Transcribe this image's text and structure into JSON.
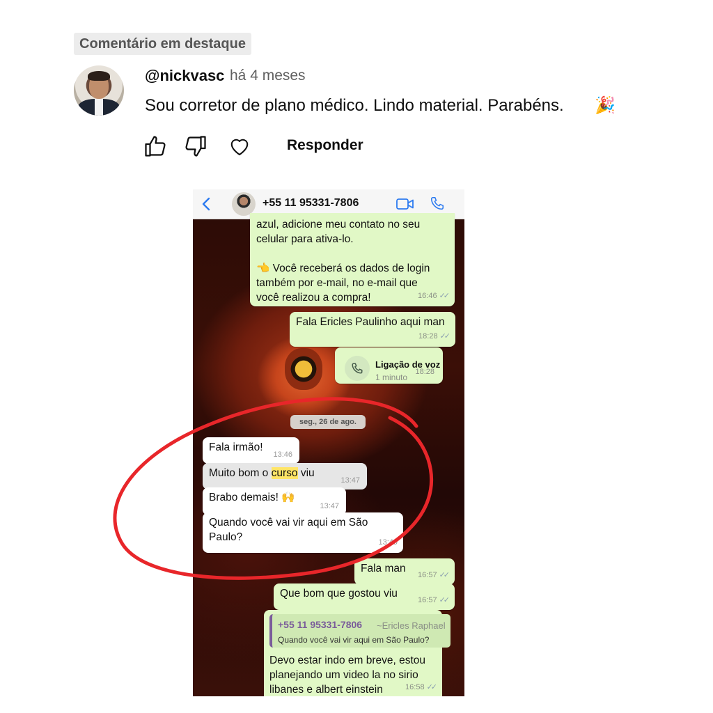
{
  "comment": {
    "pinned_label": "Comentário em destaque",
    "author": "@nickvasc",
    "time_ago": "há 4 meses",
    "text": "Sou corretor de plano médico. Lindo material. Parabéns.",
    "emoji": "🎉",
    "actions": {
      "like_icon": "thumbs-up-icon",
      "dislike_icon": "thumbs-down-icon",
      "heart_icon": "heart-icon",
      "reply_label": "Responder"
    }
  },
  "whatsapp": {
    "contact": "+55 11 95331-7806",
    "icons": [
      "back-chevron-icon",
      "video-call-icon",
      "phone-call-icon"
    ],
    "accent_color": "#2d7bf0",
    "messages": [
      {
        "dir": "out",
        "text_lines": [
          "azul, adicione meu contato no seu",
          "celular para ativa-lo."
        ]
      },
      {
        "dir": "out",
        "text_lines": [
          "👈 Você receberá os dados de login",
          "também por e-mail, no e-mail que",
          "você realizou a compra!"
        ],
        "time": "16:46"
      },
      {
        "dir": "out",
        "text": "Fala Ericles Paulinho aqui man",
        "time": "18:28"
      },
      {
        "dir": "out",
        "type": "call",
        "title": "Ligação de voz",
        "subtitle": "1 minuto",
        "time": "18:28"
      },
      {
        "dir": "in",
        "text": "Fala irmão!",
        "time": "13:46"
      },
      {
        "dir": "in",
        "text_before": "Muito bom o ",
        "highlight": "curso",
        "text_after": " viu",
        "time": "13:47"
      },
      {
        "dir": "in",
        "text": "Brabo demais! 🙌",
        "time": "13:47"
      },
      {
        "dir": "in",
        "text_lines": [
          "Quando você vai vir aqui em São",
          "Paulo?"
        ],
        "time": "13:49"
      },
      {
        "dir": "out",
        "text": "Fala man",
        "time": "16:57"
      },
      {
        "dir": "out",
        "text": "Que bom que gostou viu",
        "time": "16:57"
      },
      {
        "dir": "out",
        "quote_author": "+55 11 95331-7806",
        "quote_alias": "~Ericles Raphael",
        "quote_text": "Quando você vai vir aqui em São Paulo?",
        "text_lines": [
          "Devo estar indo em breve, estou",
          "planejando um video la no sirio",
          "libanes e albert einstein"
        ],
        "time": "16:58"
      }
    ],
    "date_separator": "seg., 26 de ago."
  }
}
